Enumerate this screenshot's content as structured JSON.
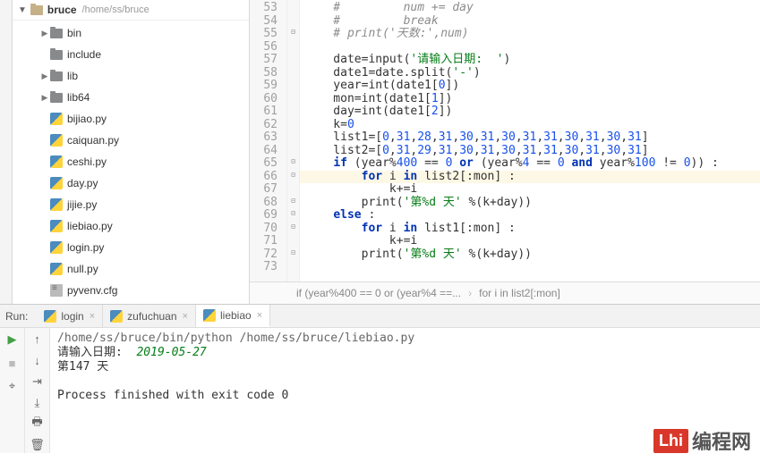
{
  "sidebar": {
    "root": {
      "name": "bruce",
      "path": "/home/ss/bruce"
    },
    "items": [
      {
        "type": "folder",
        "label": "bin",
        "expandable": true
      },
      {
        "type": "folder",
        "label": "include",
        "expandable": false
      },
      {
        "type": "folder",
        "label": "lib",
        "expandable": true
      },
      {
        "type": "folder",
        "label": "lib64",
        "expandable": true
      },
      {
        "type": "py",
        "label": "bijiao.py"
      },
      {
        "type": "py",
        "label": "caiquan.py"
      },
      {
        "type": "py",
        "label": "ceshi.py"
      },
      {
        "type": "py",
        "label": "day.py"
      },
      {
        "type": "py",
        "label": "jijie.py"
      },
      {
        "type": "py",
        "label": "liebiao.py"
      },
      {
        "type": "py",
        "label": "login.py"
      },
      {
        "type": "py",
        "label": "null.py"
      },
      {
        "type": "cfg",
        "label": "pyvenv.cfg"
      }
    ]
  },
  "editor": {
    "first_line": 53,
    "lines": [
      {
        "n": 53,
        "raw": "    #         num += day",
        "cls": "cmt"
      },
      {
        "n": 54,
        "raw": "    #         break",
        "cls": "cmt"
      },
      {
        "n": 55,
        "raw": "    # print('天数:',num)",
        "cls": "cmt"
      },
      {
        "n": 56,
        "raw": ""
      },
      {
        "n": 57,
        "raw": "    date=input('请输入日期:  ')"
      },
      {
        "n": 58,
        "raw": "    date1=date.split('-')"
      },
      {
        "n": 59,
        "raw": "    year=int(date1[0])"
      },
      {
        "n": 60,
        "raw": "    mon=int(date1[1])"
      },
      {
        "n": 61,
        "raw": "    day=int(date1[2])"
      },
      {
        "n": 62,
        "raw": "    k=0"
      },
      {
        "n": 63,
        "raw": "    list1=[0,31,28,31,30,31,30,31,31,30,31,30,31]"
      },
      {
        "n": 64,
        "raw": "    list2=[0,31,29,31,30,31,30,31,31,30,31,30,31]"
      },
      {
        "n": 65,
        "raw": "    if (year%400 == 0 or (year%4 == 0 and year%100 != 0)) :"
      },
      {
        "n": 66,
        "raw": "        for i in list2[:mon] :",
        "hl": true
      },
      {
        "n": 67,
        "raw": "            k+=i"
      },
      {
        "n": 68,
        "raw": "        print('第%d 天' %(k+day))"
      },
      {
        "n": 69,
        "raw": "    else :"
      },
      {
        "n": 70,
        "raw": "        for i in list1[:mon] :"
      },
      {
        "n": 71,
        "raw": "            k+=i"
      },
      {
        "n": 72,
        "raw": "        print('第%d 天' %(k+day))"
      },
      {
        "n": 73,
        "raw": ""
      }
    ],
    "breadcrumb": {
      "a": "if (year%400 == 0 or (year%4 ==...",
      "b": "for i in list2[:mon]"
    }
  },
  "run": {
    "label": "Run:",
    "tabs": [
      {
        "label": "login",
        "active": false
      },
      {
        "label": "zufuchuan",
        "active": false
      },
      {
        "label": "liebiao",
        "active": true
      }
    ],
    "console": {
      "cmd": "/home/ss/bruce/bin/python /home/ss/bruce/liebiao.py",
      "prompt": "请输入日期:  ",
      "input": "2019-05-27",
      "out1": "第147 天",
      "out2": "Process finished with exit code 0"
    }
  },
  "watermark": {
    "logo": "Lhi",
    "text": "编程网"
  }
}
